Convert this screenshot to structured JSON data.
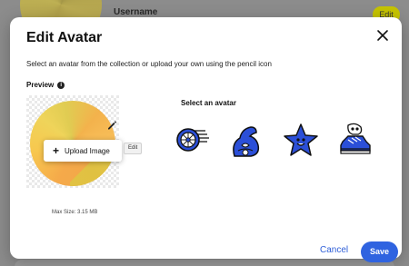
{
  "background": {
    "username_label": "Username",
    "edit_button_label": "Edit"
  },
  "modal": {
    "title": "Edit Avatar",
    "description": "Select an avatar from the collection or upload your own using the pencil icon",
    "preview": {
      "label": "Preview",
      "upload_menu_label": "Upload Image",
      "tooltip": "Edit",
      "max_size": "Max Size: 3.15 MB"
    },
    "avatar_section": {
      "label": "Select an avatar",
      "options": [
        {
          "name": "wheel-avatar-icon"
        },
        {
          "name": "flexed-arm-avatar-icon"
        },
        {
          "name": "star-avatar-icon"
        },
        {
          "name": "skull-sneaker-avatar-icon"
        }
      ]
    },
    "actions": {
      "cancel": "Cancel",
      "save": "Save"
    }
  },
  "colors": {
    "accent": "#2f63e0",
    "avatar_blue": "#2b4fd8",
    "preview_yellow": "#f7c84f",
    "background_edit_button": "#c6c400"
  }
}
